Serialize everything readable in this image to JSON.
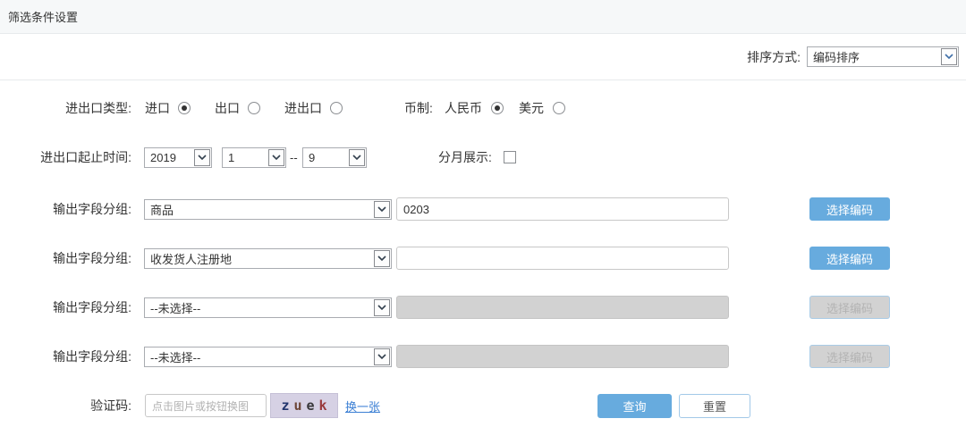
{
  "page": {
    "title": "筛选条件设置"
  },
  "sort": {
    "label": "排序方式:",
    "value": "编码排序"
  },
  "trade_type": {
    "label": "进出口类型:",
    "options": [
      {
        "label": "进口",
        "selected": true
      },
      {
        "label": "出口",
        "selected": false
      },
      {
        "label": "进出口",
        "selected": false
      }
    ]
  },
  "currency": {
    "label": "币制:",
    "options": [
      {
        "label": "人民币",
        "selected": true
      },
      {
        "label": "美元",
        "selected": false
      }
    ]
  },
  "date_range": {
    "label": "进出口起止时间:",
    "year": "2019",
    "start_month": "1",
    "separator": "--",
    "end_month": "9"
  },
  "monthly": {
    "label": "分月展示:",
    "checked": false
  },
  "output_groups": {
    "rows": [
      {
        "label": "输出字段分组:",
        "select": "商品",
        "input": "0203",
        "button": "选择编码",
        "enabled": true
      },
      {
        "label": "输出字段分组:",
        "select": "收发货人注册地",
        "input": "",
        "button": "选择编码",
        "enabled": true
      },
      {
        "label": "输出字段分组:",
        "select": "--未选择--",
        "input": "",
        "button": "选择编码",
        "enabled": false
      },
      {
        "label": "输出字段分组:",
        "select": "--未选择--",
        "input": "",
        "button": "选择编码",
        "enabled": false
      }
    ]
  },
  "captcha": {
    "label": "验证码:",
    "placeholder": "点击图片或按钮换图",
    "image_text": "zuek",
    "chars": [
      {
        "ch": "z",
        "color": "#22356e"
      },
      {
        "ch": "u",
        "color": "#6d4636"
      },
      {
        "ch": "e",
        "color": "#38383a"
      },
      {
        "ch": "k",
        "color": "#99393c"
      }
    ],
    "refresh_link": "换一张"
  },
  "actions": {
    "query": "查询",
    "reset": "重置"
  },
  "colors": {
    "accent_blue": "#67abde",
    "link_blue": "#3b7fd4",
    "disabled_gray": "#d2d2d2",
    "divider": "#e7eaec",
    "titlebar_bg": "#f6f8f9",
    "captcha_bg": "#d6d1e4"
  }
}
